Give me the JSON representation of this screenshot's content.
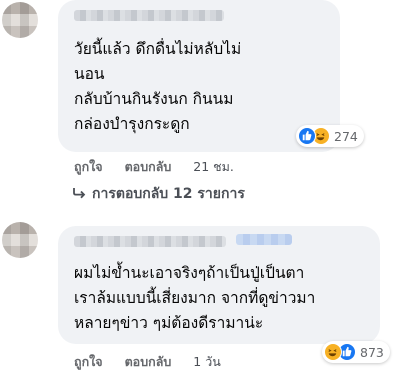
{
  "comments": [
    {
      "lines": [
        "วัยนี้แล้ว ดึกดื่นไม่หลับไม่",
        "นอน",
        "กลับบ้านกินรังนก กินนม",
        "กล่องบำรุงกระดูก"
      ],
      "reaction_icons": [
        "like-icon",
        "haha-icon"
      ],
      "reaction_count": "274",
      "like_label": "ถูกใจ",
      "reply_label": "ตอบกลับ",
      "time": "21 ชม."
    },
    {
      "lines": [
        "ผมไม่ข้ำนะเอาจริงๆถ้าเป็นปู่เป็นตา",
        "เราล้มแบบนี้เสี่ยงมาก จากที่ดูข่าวมา",
        "หลายๆข่าว ๆม่ต้องดีรามาน่ะ"
      ],
      "reaction_icons": [
        "haha-icon",
        "like-icon"
      ],
      "reaction_count": "873",
      "like_label": "ถูกใจ",
      "reply_label": "ตอบกลับ",
      "time": "1 วัน"
    }
  ],
  "replies_link": "การตอบกลับ 12 รายการ",
  "colors": {
    "bubble": "#f0f2f5",
    "like": "#1877f2",
    "haha": "#f7b125"
  }
}
